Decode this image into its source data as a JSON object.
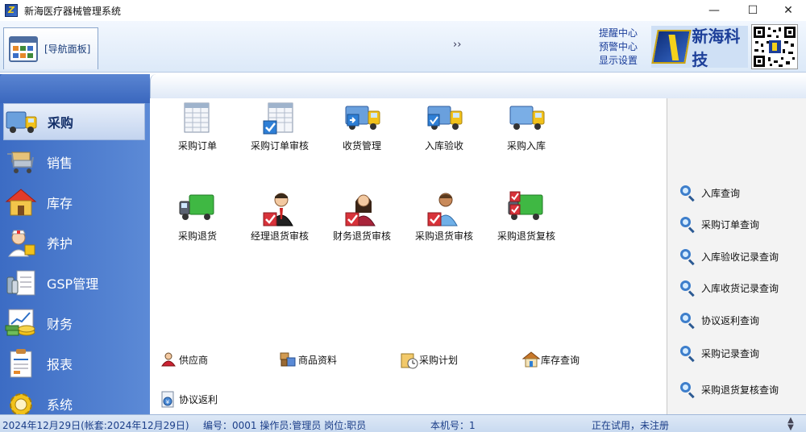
{
  "window": {
    "title": "新海医疗器械管理系统",
    "controls": {
      "minimize": "—",
      "maximize": "☐",
      "close": "✕"
    }
  },
  "header": {
    "nav_panel_label": "[导航面板]",
    "expand_glyph": "››",
    "links": [
      "提醒中心",
      "预警中心",
      "显示设置"
    ],
    "brand_name": "新海科技"
  },
  "sidebar": {
    "items": [
      {
        "label": "采购",
        "icon": "truck-icon",
        "active": true
      },
      {
        "label": "销售",
        "icon": "shopping-cart-icon",
        "active": false
      },
      {
        "label": "库存",
        "icon": "warehouse-house-icon",
        "active": false
      },
      {
        "label": "养护",
        "icon": "nurse-icon",
        "active": false
      },
      {
        "label": "GSP管理",
        "icon": "document-bottles-icon",
        "active": false
      },
      {
        "label": "财务",
        "icon": "finance-coins-icon",
        "active": false
      },
      {
        "label": "报表",
        "icon": "report-clipboard-icon",
        "active": false
      },
      {
        "label": "系统",
        "icon": "gear-icon",
        "active": false
      }
    ]
  },
  "main": {
    "tiles_row1": [
      {
        "label": "采购订单",
        "icon": "purchase-order-icon"
      },
      {
        "label": "采购订单审核",
        "icon": "order-review-icon"
      },
      {
        "label": "收货管理",
        "icon": "receiving-truck-icon"
      },
      {
        "label": "入库验收",
        "icon": "inbound-inspection-truck-icon"
      },
      {
        "label": "采购入库",
        "icon": "purchase-inbound-truck-icon"
      }
    ],
    "tiles_row2": [
      {
        "label": "采购退货",
        "icon": "return-truck-icon"
      },
      {
        "label": "经理退货审核",
        "icon": "manager-review-icon"
      },
      {
        "label": "财务退货审核",
        "icon": "finance-review-icon"
      },
      {
        "label": "采购退货审核",
        "icon": "purchase-return-review-icon"
      },
      {
        "label": "采购退货复核",
        "icon": "return-recheck-truck-icon"
      }
    ],
    "quick_links": [
      {
        "label": "供应商",
        "icon": "supplier-icon"
      },
      {
        "label": "商品资料",
        "icon": "product-info-icon"
      },
      {
        "label": "采购计划",
        "icon": "purchase-plan-icon"
      },
      {
        "label": "库存查询",
        "icon": "inventory-house-icon"
      },
      {
        "label": "协议返利",
        "icon": "rebate-icon"
      }
    ]
  },
  "right_panel": {
    "links": [
      "入库查询",
      "采购订单查询",
      "入库验收记录查询",
      "入库收货记录查询",
      "协议返利查询",
      "采购记录查询",
      "采购退货复核查询"
    ]
  },
  "statusbar": {
    "date": "2024年12月29日(帐套:2024年12月29日)",
    "operator": "编号：0001 操作员:管理员 岗位:职员",
    "machine": "本机号：1",
    "license": "正在试用，未注册"
  },
  "colors": {
    "sidebar_blue": "#4a78cc",
    "link_blue": "#1a3d9a",
    "brand_gold": "#f4d11b"
  }
}
